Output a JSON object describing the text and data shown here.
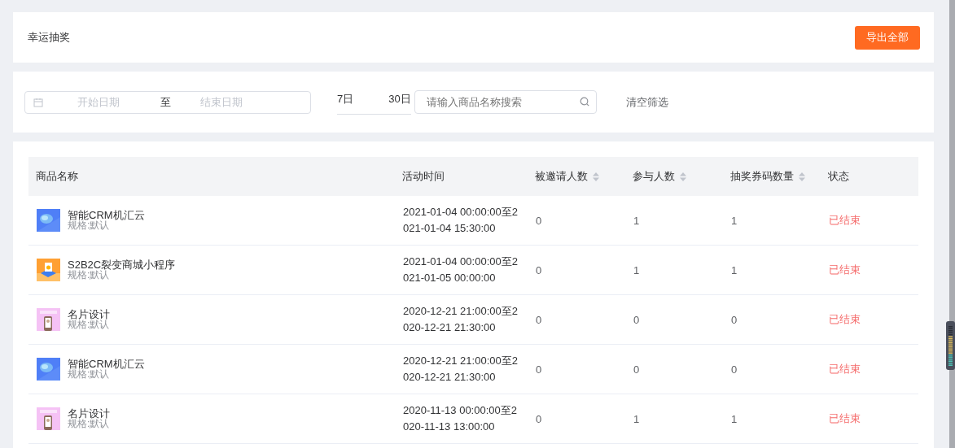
{
  "header": {
    "title": "幸运抽奖",
    "export_button": "导出全部"
  },
  "filters": {
    "start_placeholder": "开始日期",
    "range_separator": "至",
    "end_placeholder": "结束日期",
    "quick_ranges": [
      "7日",
      "30日"
    ],
    "search": {
      "placeholder": "请输入商品名称搜索"
    },
    "clear_link": "清空筛选"
  },
  "table": {
    "columns": [
      {
        "label": "商品名称",
        "sortable": false
      },
      {
        "label": "活动时间",
        "sortable": false
      },
      {
        "label": "被邀请人数",
        "sortable": true
      },
      {
        "label": "参与人数",
        "sortable": true
      },
      {
        "label": "抽奖券码数量",
        "sortable": true
      },
      {
        "label": "状态",
        "sortable": false
      }
    ],
    "rows": [
      {
        "product": "智能CRM机汇云",
        "spec": "规格:默认",
        "time": "2021-01-04 00:00:00至2021-01-04 15:30:00",
        "invited": "0",
        "participants": "1",
        "codes": "1",
        "status": "已结束"
      },
      {
        "product": "S2B2C裂变商城小程序",
        "spec": "规格:默认",
        "time": "2021-01-04 00:00:00至2021-01-05 00:00:00",
        "invited": "0",
        "participants": "1",
        "codes": "1",
        "status": "已结束"
      },
      {
        "product": "名片设计",
        "spec": "规格:默认",
        "time": "2020-12-21 21:00:00至2020-12-21 21:30:00",
        "invited": "0",
        "participants": "0",
        "codes": "0",
        "status": "已结束"
      },
      {
        "product": "智能CRM机汇云",
        "spec": "规格:默认",
        "time": "2020-12-21 21:00:00至2020-12-21 21:30:00",
        "invited": "0",
        "participants": "0",
        "codes": "0",
        "status": "已结束"
      },
      {
        "product": "名片设计",
        "spec": "规格:默认",
        "time": "2020-11-13 00:00:00至2020-11-13 13:00:00",
        "invited": "0",
        "participants": "1",
        "codes": "1",
        "status": "已结束"
      }
    ]
  }
}
